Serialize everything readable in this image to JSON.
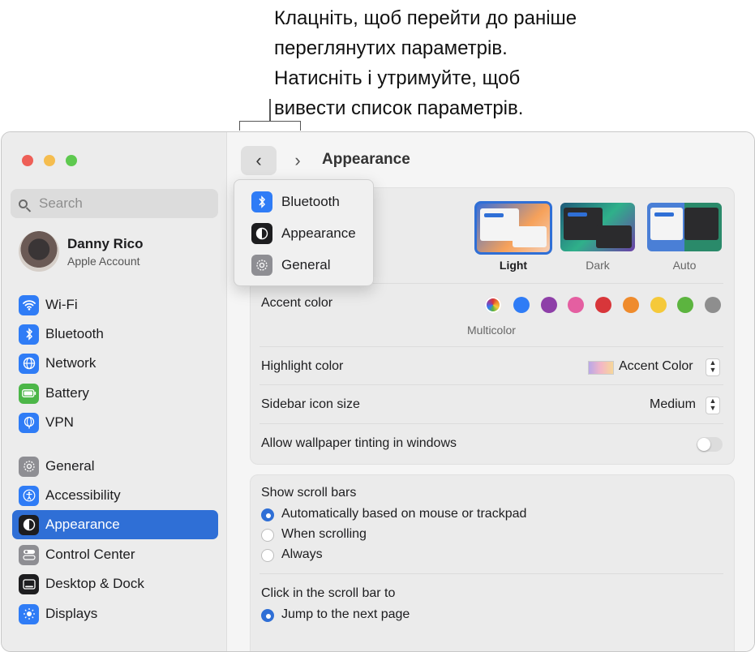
{
  "callout": {
    "text": "Клацніть, щоб перейти до раніше\nпереглянутих параметрів.\nНатисніть і утримуйте, щоб\nвивести список параметрів."
  },
  "sidebar": {
    "search_placeholder": "Search",
    "user": {
      "name": "Danny Rico",
      "subtitle": "Apple Account"
    },
    "items": [
      {
        "label": "Wi-Fi",
        "icon": "wifi-icon",
        "color": "#2f7cf6"
      },
      {
        "label": "Bluetooth",
        "icon": "bluetooth-icon",
        "color": "#2f7cf6"
      },
      {
        "label": "Network",
        "icon": "globe-icon",
        "color": "#2f7cf6"
      },
      {
        "label": "Battery",
        "icon": "battery-icon",
        "color": "#4cb648"
      },
      {
        "label": "VPN",
        "icon": "globe-vpn-icon",
        "color": "#2f7cf6"
      },
      {
        "label": "General",
        "icon": "gear-icon",
        "color": "#8e8e93"
      },
      {
        "label": "Accessibility",
        "icon": "accessibility-icon",
        "color": "#2f7cf6"
      },
      {
        "label": "Appearance",
        "icon": "appearance-icon",
        "color": "#1d1d1f",
        "active": true
      },
      {
        "label": "Control Center",
        "icon": "control-center-icon",
        "color": "#8e8e93"
      },
      {
        "label": "Desktop & Dock",
        "icon": "desktop-dock-icon",
        "color": "#1d1d1f"
      },
      {
        "label": "Displays",
        "icon": "displays-icon",
        "color": "#2f7cf6"
      }
    ]
  },
  "header": {
    "title": "Appearance"
  },
  "history_menu": {
    "items": [
      {
        "label": "Bluetooth",
        "icon": "bluetooth-icon",
        "color": "#2f7cf6"
      },
      {
        "label": "Appearance",
        "icon": "appearance-icon",
        "color": "#1d1d1f"
      },
      {
        "label": "General",
        "icon": "gear-icon",
        "color": "#8e8e93"
      }
    ]
  },
  "appearance": {
    "themes": [
      {
        "label": "Light",
        "selected": true
      },
      {
        "label": "Dark",
        "selected": false
      },
      {
        "label": "Auto",
        "selected": false
      }
    ]
  },
  "accent": {
    "label": "Accent color",
    "selected_name": "Multicolor",
    "colors": [
      "multicolor",
      "#2f7cf6",
      "#8e3fa8",
      "#e45fa1",
      "#d8363a",
      "#ef8b2c",
      "#f5c93a",
      "#5cb43f",
      "#8e8e8e"
    ]
  },
  "highlight": {
    "label": "Highlight color",
    "value": "Accent Color"
  },
  "sidebar_icon_size": {
    "label": "Sidebar icon size",
    "value": "Medium"
  },
  "wallpaper_tinting": {
    "label": "Allow wallpaper tinting in windows",
    "enabled": false
  },
  "scroll_bars": {
    "label": "Show scroll bars",
    "options": [
      {
        "label": "Automatically based on mouse or trackpad",
        "selected": true
      },
      {
        "label": "When scrolling",
        "selected": false
      },
      {
        "label": "Always",
        "selected": false
      }
    ]
  },
  "click_scroll": {
    "label": "Click in the scroll bar to",
    "options": [
      {
        "label": "Jump to the next page",
        "selected": true
      }
    ]
  },
  "colors": {
    "accent": "#2f6fd6"
  }
}
